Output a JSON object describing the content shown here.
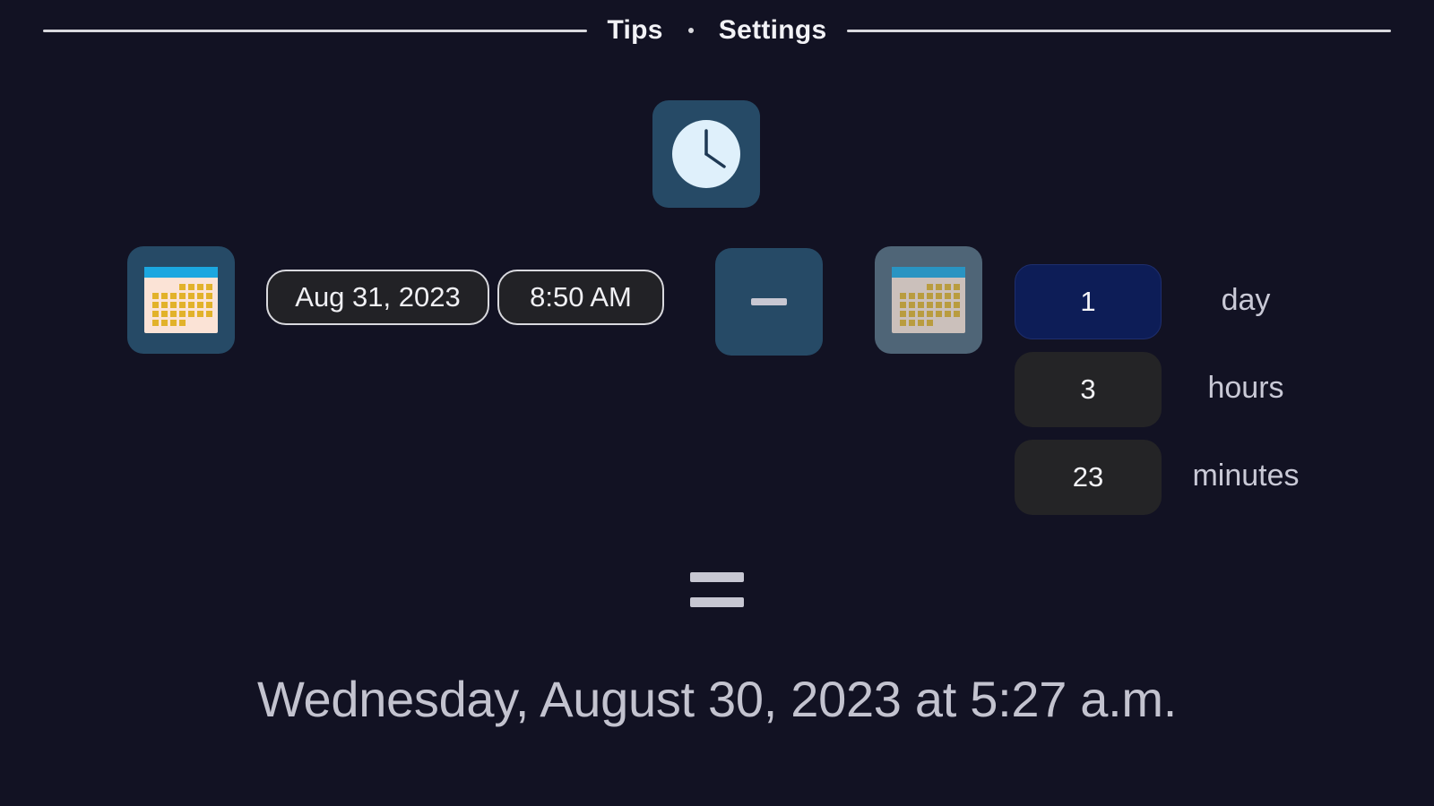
{
  "nav": {
    "tips_label": "Tips",
    "settings_label": "Settings"
  },
  "icons": {
    "clock": "clock-icon",
    "calendar_from": "calendar-icon",
    "minus": "minus-icon",
    "calendar_to": "calendar-icon",
    "equals": "equals-icon"
  },
  "start": {
    "date": "Aug 31, 2023",
    "time": "8:50 AM"
  },
  "duration": {
    "days_value": "1",
    "days_label": "day",
    "hours_value": "3",
    "hours_label": "hours",
    "minutes_value": "23",
    "minutes_label": "minutes"
  },
  "result": {
    "text": "Wednesday, August 30, 2023 at 5:27 a.m."
  },
  "colors": {
    "background": "#121223",
    "tile": "#264a66",
    "tile_muted": "#4f6577",
    "active_field": "#0d1d57"
  }
}
